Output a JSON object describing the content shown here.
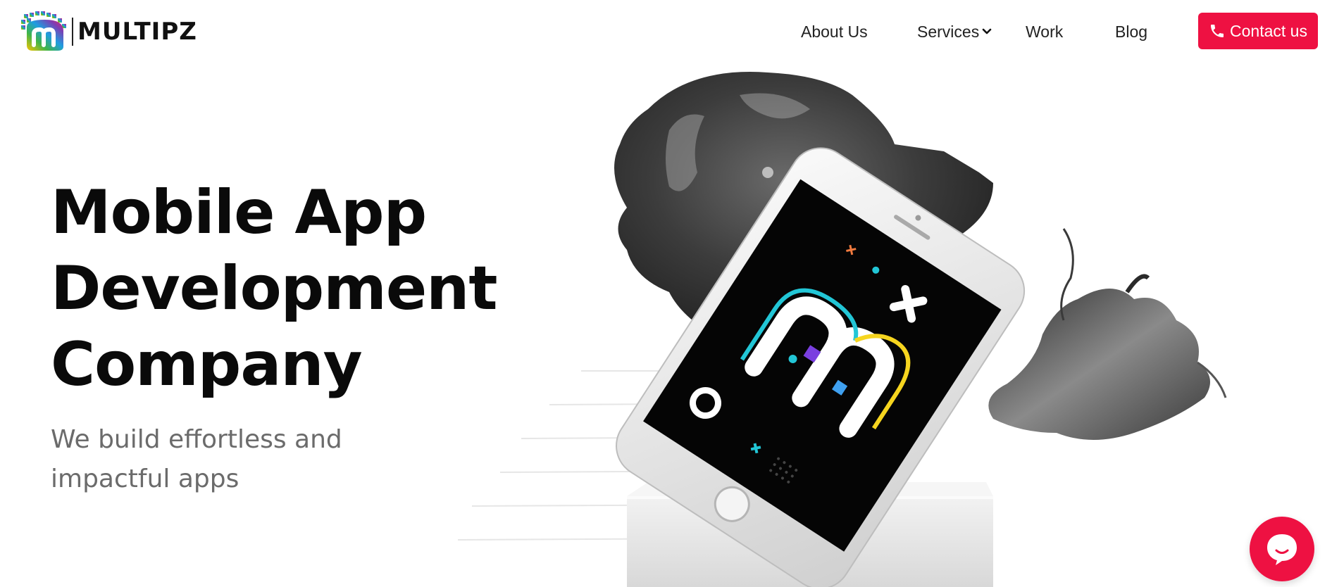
{
  "brand": {
    "name": "MULTIPZ",
    "logo_icon": "multipz-m-logo-icon"
  },
  "nav": {
    "items": [
      {
        "label": "About Us"
      },
      {
        "label": "Services",
        "icon": "chevron-down-icon"
      },
      {
        "label": "Work"
      },
      {
        "label": "Blog"
      }
    ],
    "contact": {
      "label": "Contact us",
      "icon": "phone-icon"
    }
  },
  "hero": {
    "title_lines": [
      "Mobile App",
      "Development",
      "Company"
    ],
    "subtitle_lines": [
      "We build effortless and",
      "impactful apps"
    ]
  },
  "illustration": {
    "description_icon": "phone-on-pedestal-with-ink-splash",
    "phone_icon": "smartphone-icon"
  },
  "chat": {
    "icon": "chat-bubble-icon"
  },
  "colors": {
    "accent": "#ee1142",
    "text": "#0a0a0a",
    "subtext": "#6b6b6b",
    "background": "#ffffff"
  }
}
